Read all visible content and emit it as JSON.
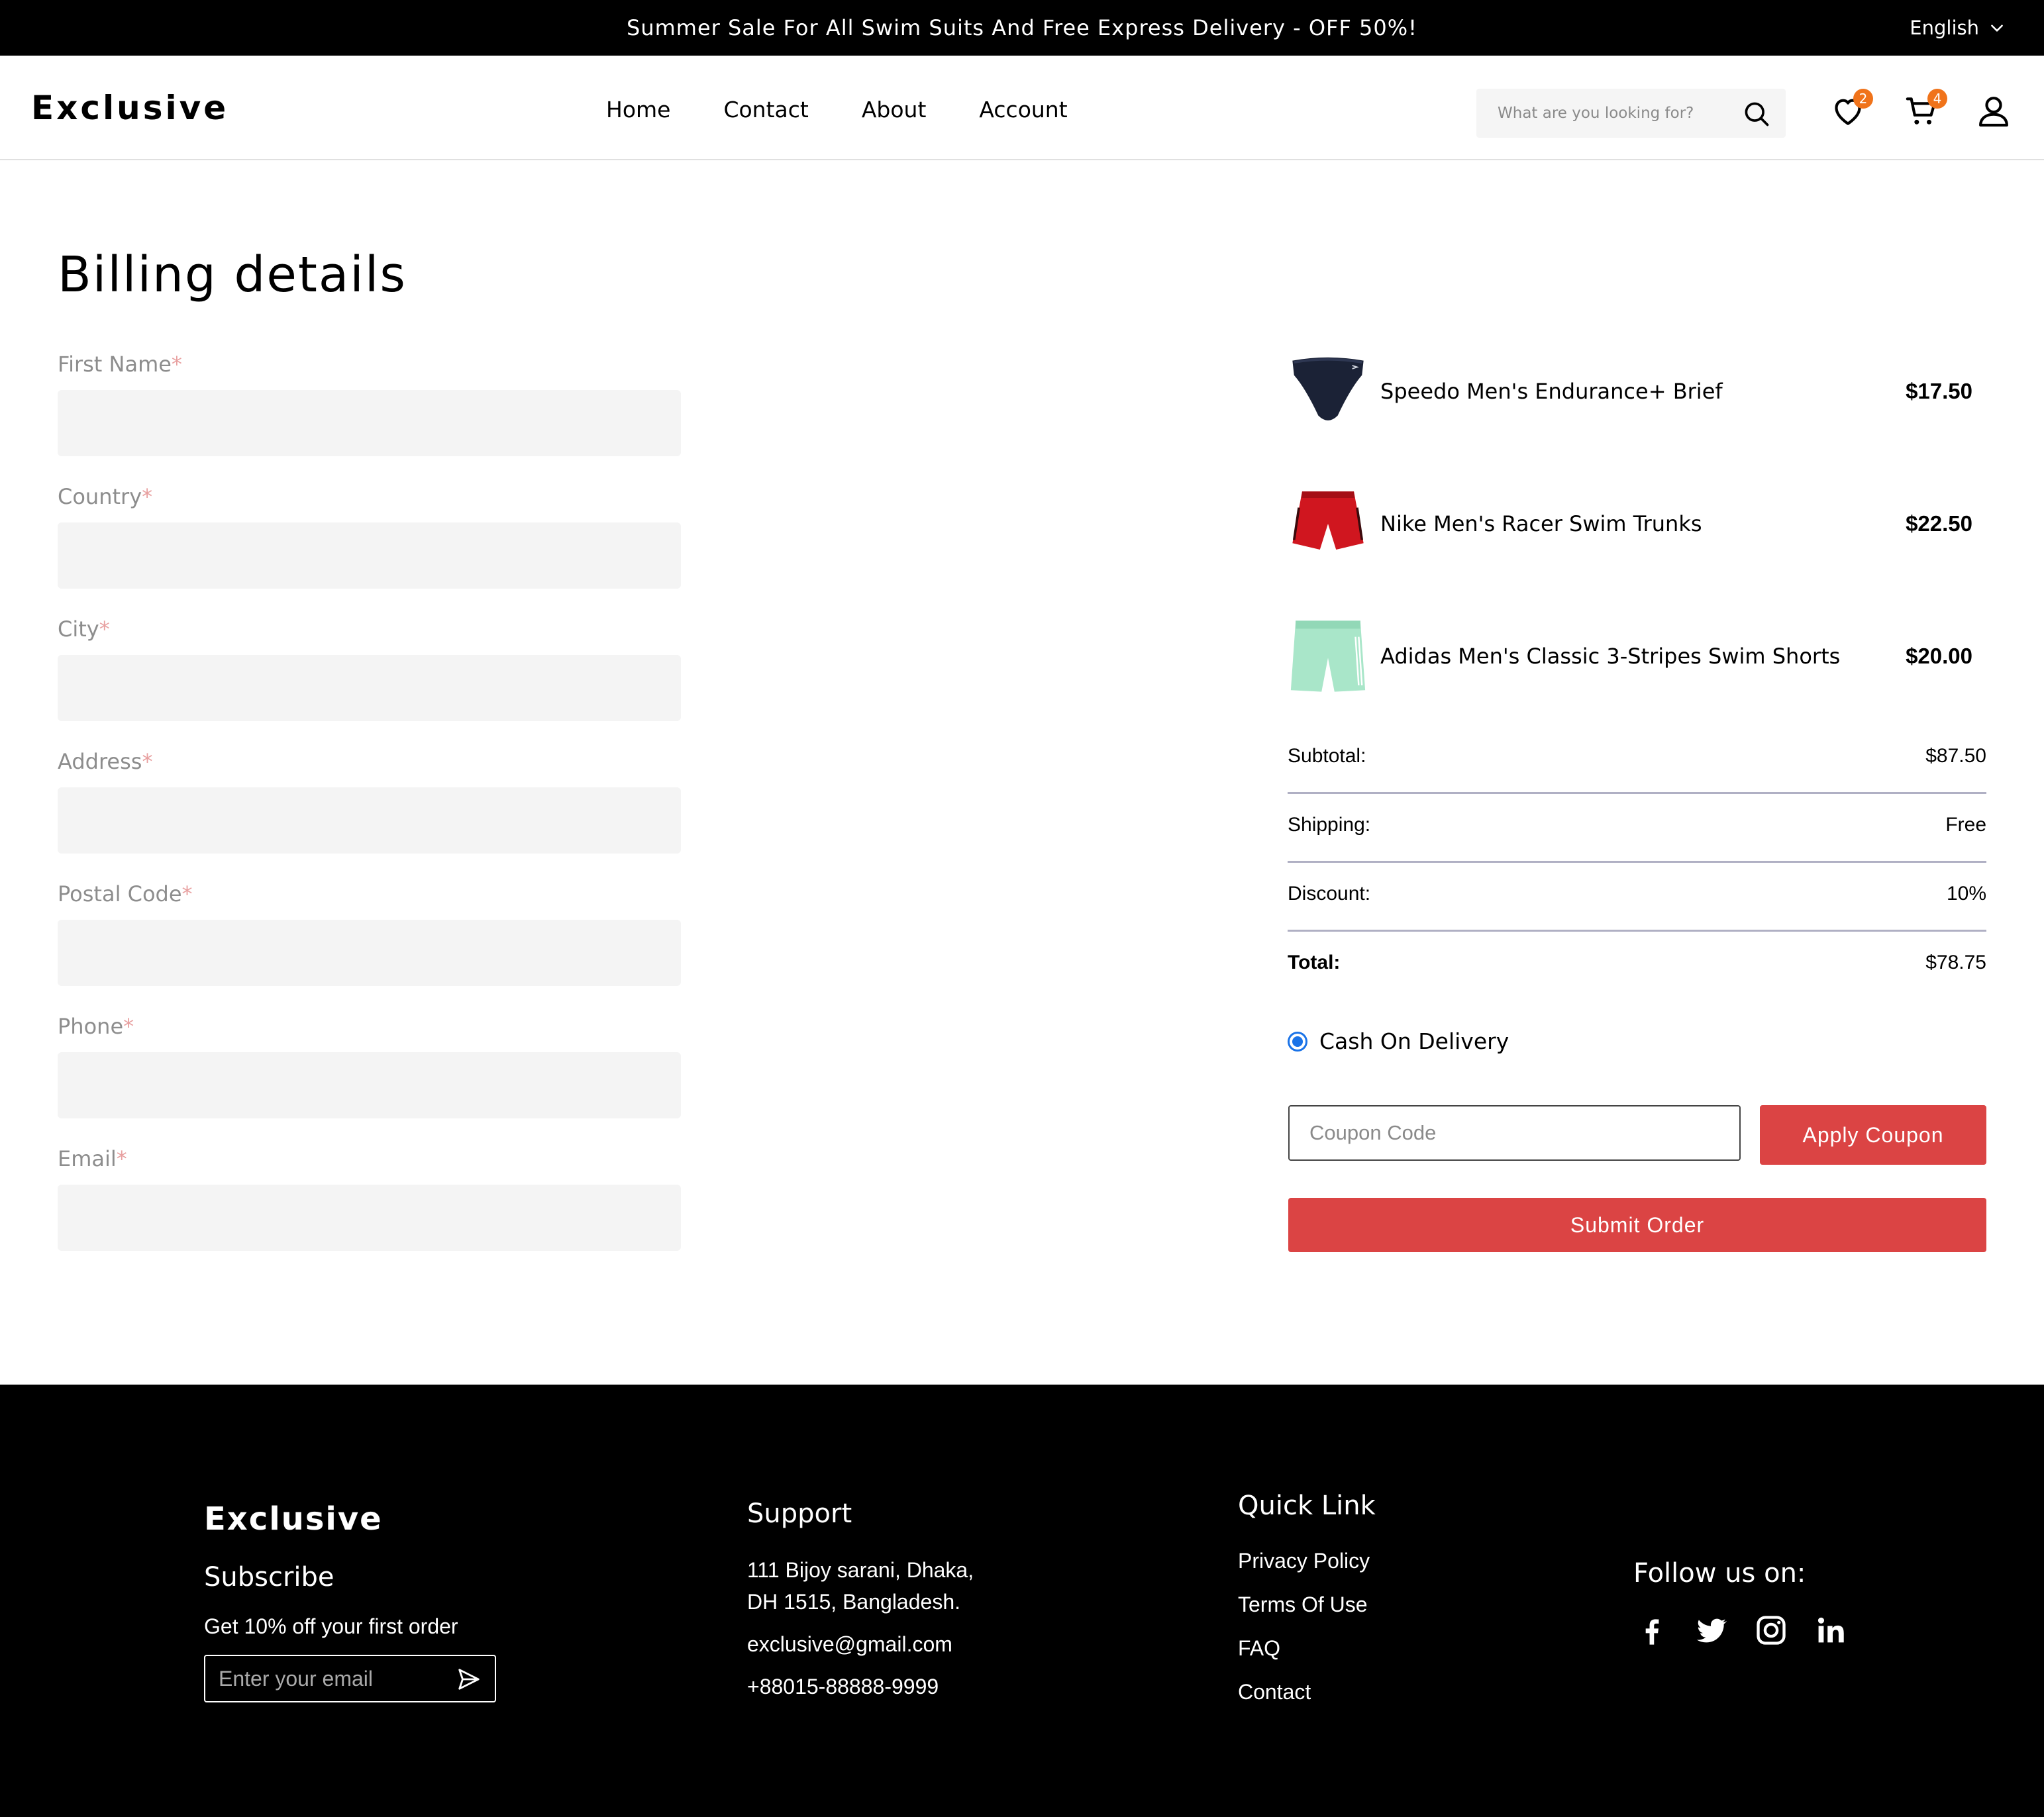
{
  "topbar": {
    "promo": "Summer Sale For All Swim Suits And Free Express Delivery - OFF 50%!",
    "language": "English"
  },
  "header": {
    "logo": "Exclusive",
    "nav": [
      "Home",
      "Contact",
      "About",
      "Account"
    ],
    "search_placeholder": "What are you looking for?",
    "wishlist_count": "2",
    "cart_count": "4"
  },
  "billing": {
    "title": "Billing details",
    "fields": [
      {
        "label": "First Name",
        "required": "*",
        "value": ""
      },
      {
        "label": "Country",
        "required": "*",
        "value": ""
      },
      {
        "label": "City",
        "required": "*",
        "value": ""
      },
      {
        "label": "Address",
        "required": "*",
        "value": ""
      },
      {
        "label": "Postal Code",
        "required": "*",
        "value": ""
      },
      {
        "label": "Phone",
        "required": "*",
        "value": ""
      },
      {
        "label": "Email",
        "required": "*",
        "value": ""
      }
    ]
  },
  "order": {
    "items": [
      {
        "name": "Speedo Men's Endurance+ Brief",
        "price": "$17.50",
        "image": "navy-swim-brief"
      },
      {
        "name": "Nike Men's Racer Swim Trunks",
        "price": "$22.50",
        "image": "red-swim-trunks"
      },
      {
        "name": "Adidas Men's Classic 3-Stripes Swim Shorts",
        "price": "$20.00",
        "image": "mint-swim-shorts"
      }
    ],
    "summary": {
      "subtotal_label": "Subtotal:",
      "subtotal": "$87.50",
      "shipping_label": "Shipping:",
      "shipping": "Free",
      "discount_label": "Discount:",
      "discount": "10%",
      "total_label": "Total:",
      "total": "$78.75"
    },
    "payment_method": "Cash On Delivery",
    "coupon_placeholder": "Coupon Code",
    "apply_coupon": "Apply Coupon",
    "submit": "Submit Order"
  },
  "footer": {
    "logo": "Exclusive",
    "subscribe": "Subscribe",
    "offer": "Get 10% off your first order",
    "email_placeholder": "Enter your email",
    "support_title": "Support",
    "address_line1": "111 Bijoy sarani, Dhaka,",
    "address_line2": "DH 1515, Bangladesh.",
    "email": "exclusive@gmail.com",
    "phone": "+88015-88888-9999",
    "quick_title": "Quick Link",
    "quick_links": [
      "Privacy Policy",
      "Terms Of Use",
      "FAQ",
      "Contact"
    ],
    "follow": "Follow us on:",
    "socials": [
      "facebook-icon",
      "twitter-icon",
      "instagram-icon",
      "linkedin-icon"
    ]
  },
  "colors": {
    "accent": "#db4444",
    "badge": "#f0731a",
    "radio": "#1a73e8"
  }
}
